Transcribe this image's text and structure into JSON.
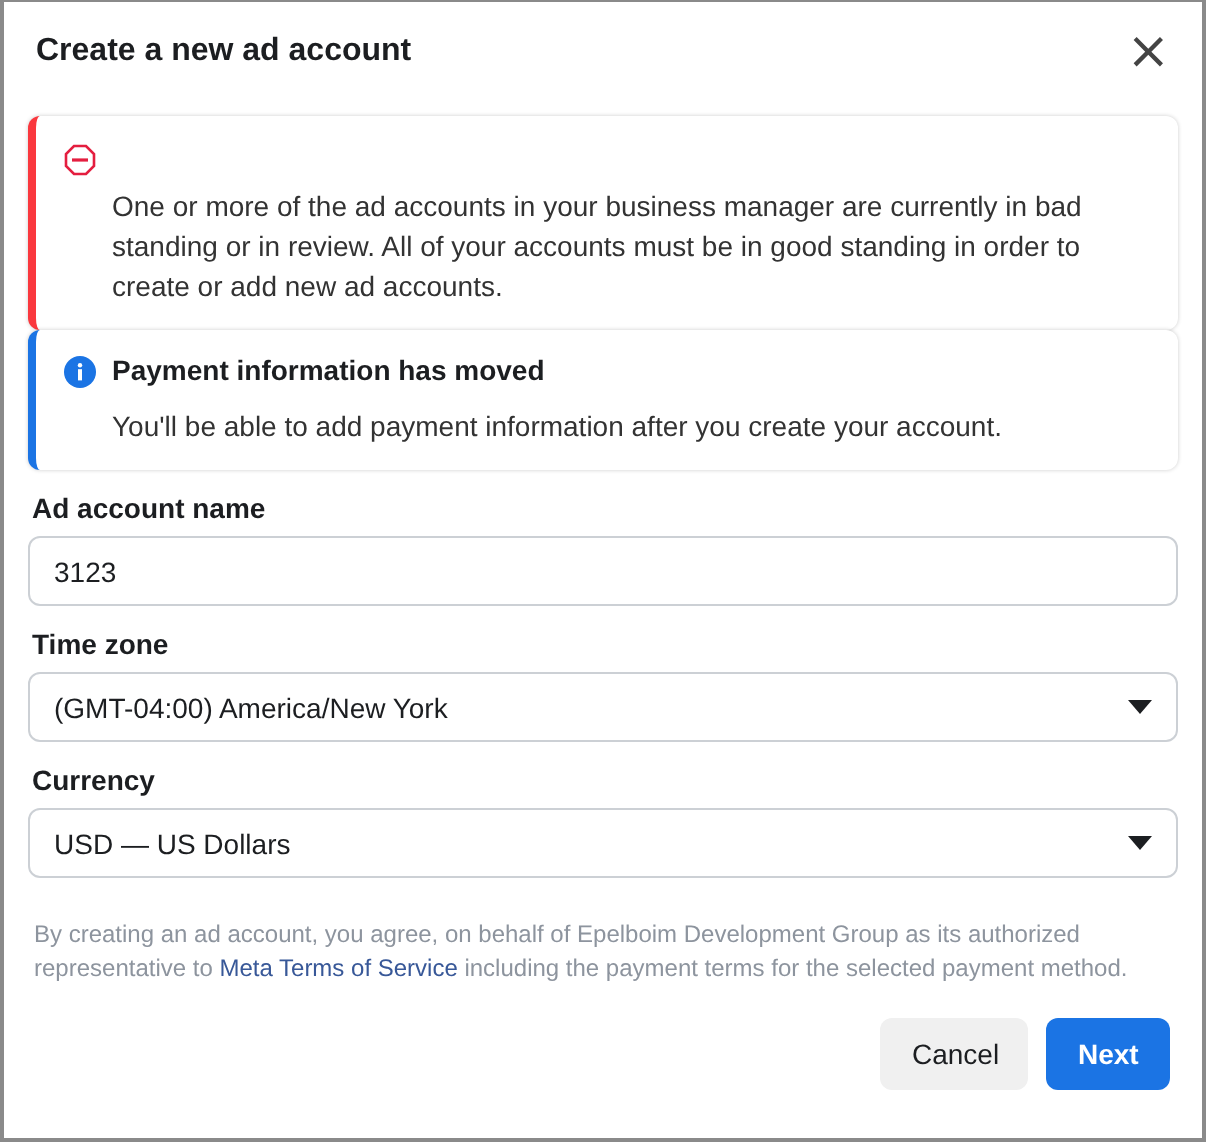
{
  "dialog": {
    "title": "Create a new ad account",
    "close": "×"
  },
  "alerts": [
    {
      "kind": "error",
      "text": "One or more of the ad accounts in your business manager are currently in bad standing or in review. All of your accounts must be in good standing in order to create or add new ad accounts."
    },
    {
      "kind": "info",
      "title": "Payment information has moved",
      "text": "You'll be able to add payment information after you create your account."
    }
  ],
  "fields": [
    {
      "kind": "text",
      "label": "Ad account name",
      "value": "3123"
    },
    {
      "kind": "select",
      "label": "Time zone",
      "value": "(GMT-04:00) America/New York"
    },
    {
      "kind": "select",
      "label": "Currency",
      "value": "USD — US Dollars"
    }
  ],
  "legal": {
    "text_before": "By creating an ad account, you agree, on behalf of Epelboim Development Group as its authorized representative to",
    "link": "Meta Terms of Service",
    "text_after": "including the payment terms for the selected payment method."
  },
  "buttons": [
    {
      "kind": "secondary",
      "label": "Cancel"
    },
    {
      "kind": "primary",
      "label": "Next"
    }
  ]
}
